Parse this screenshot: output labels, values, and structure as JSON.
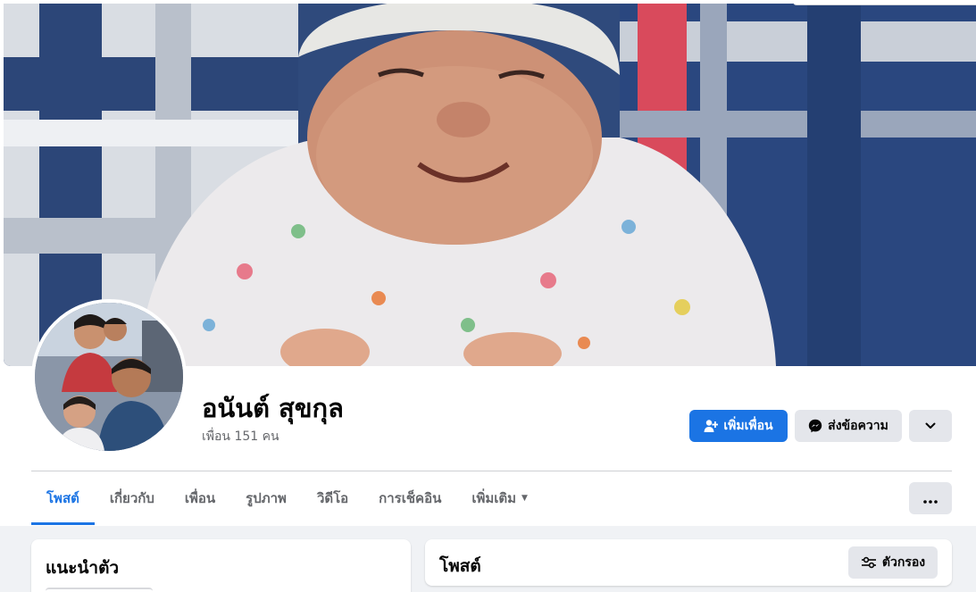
{
  "profile": {
    "name": "อนันต์ สุขกุล",
    "friends_count": "เพื่อน 151 คน"
  },
  "actions": {
    "add_friend": "เพิ่มเพื่อน",
    "message": "ส่งข้อความ"
  },
  "tabs": [
    {
      "label": "โพสต์",
      "active": true
    },
    {
      "label": "เกี่ยวกับ"
    },
    {
      "label": "เพื่อน"
    },
    {
      "label": "รูปภาพ"
    },
    {
      "label": "วิดีโอ"
    },
    {
      "label": "การเช็คอิน"
    },
    {
      "label": "เพิ่มเติม"
    }
  ],
  "intro": {
    "title": "แนะนำตัว"
  },
  "posts": {
    "title": "โพสต์",
    "filter_label": "ตัวกรอง"
  },
  "colors": {
    "accent": "#1b74e4",
    "button_grey": "#e4e6eb",
    "page_background": "#f0f2f5",
    "secondary_text": "#65676b"
  },
  "icons": {
    "add_friend": "person-plus-icon",
    "message": "messenger-icon",
    "more": "chevron-down-icon",
    "overflow": "ellipsis-icon",
    "filter": "sliders-icon",
    "tab_caret": "caret-down-icon"
  }
}
